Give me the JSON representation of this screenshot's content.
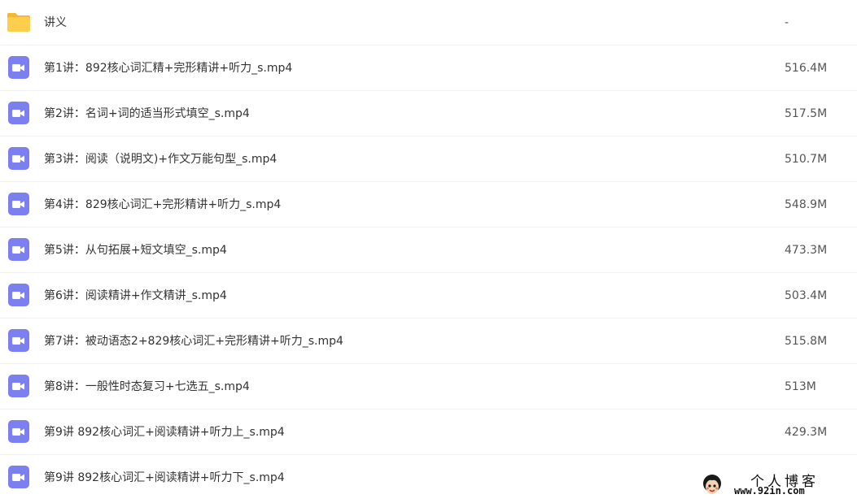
{
  "colors": {
    "folder": "#ffce4d",
    "folder_tab": "#f5b82e",
    "video": "#7b7ff0"
  },
  "files": [
    {
      "name": "讲义",
      "size": "-",
      "icon": "folder-icon"
    },
    {
      "name": "第1讲：892核心词汇精+完形精讲+听力_s.mp4",
      "size": "516.4M",
      "icon": "video-file-icon"
    },
    {
      "name": "第2讲：名词+词的适当形式填空_s.mp4",
      "size": "517.5M",
      "icon": "video-file-icon"
    },
    {
      "name": "第3讲：阅读（说明文)+作文万能句型_s.mp4",
      "size": "510.7M",
      "icon": "video-file-icon"
    },
    {
      "name": "第4讲：829核心词汇+完形精讲+听力_s.mp4",
      "size": "548.9M",
      "icon": "video-file-icon"
    },
    {
      "name": "第5讲：从句拓展+短文填空_s.mp4",
      "size": "473.3M",
      "icon": "video-file-icon"
    },
    {
      "name": "第6讲：阅读精讲+作文精讲_s.mp4",
      "size": "503.4M",
      "icon": "video-file-icon"
    },
    {
      "name": "第7讲：被动语态2+829核心词汇+完形精讲+听力_s.mp4",
      "size": "515.8M",
      "icon": "video-file-icon"
    },
    {
      "name": "第8讲：一般性时态复习+七选五_s.mp4",
      "size": "513M",
      "icon": "video-file-icon"
    },
    {
      "name": "第9讲 892核心词汇+阅读精讲+听力上_s.mp4",
      "size": "429.3M",
      "icon": "video-file-icon"
    },
    {
      "name": "第9讲 892核心词汇+阅读精讲+听力下_s.mp4",
      "size": "",
      "icon": "video-file-icon"
    }
  ],
  "watermark": {
    "title": "个人博客",
    "url": "www.92in.com",
    "icon": "avatar-icon"
  }
}
